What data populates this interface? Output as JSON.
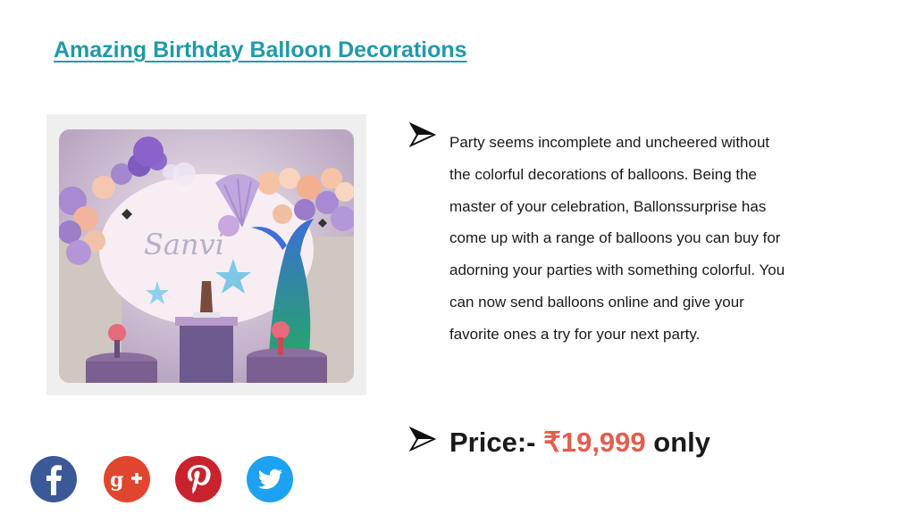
{
  "header": {
    "title": "Amazing Birthday Balloon Decorations"
  },
  "photo": {
    "sign_text": "Sanvi"
  },
  "content": {
    "description": "Party seems incomplete and uncheered without the colorful decorations of balloons. Being the master of your celebration, Ballonssurprise has come up with a range of balloons you can buy for adorning your parties with something colorful. You can now send balloons online and give your favorite ones a try for your next party.",
    "price_label": "Price:- ",
    "price_value": "₹19,999",
    "price_suffix": " only"
  },
  "social": [
    {
      "icon": "facebook-icon",
      "glyph": "f",
      "color": "#3b5998"
    },
    {
      "icon": "google-plus-icon",
      "glyph": "g+",
      "color": "#e0462f"
    },
    {
      "icon": "pinterest-icon",
      "glyph": "p",
      "color": "#c8232c"
    },
    {
      "icon": "twitter-icon",
      "glyph": "bird",
      "color": "#1da1f2"
    }
  ],
  "colors": {
    "title": "#1f9aa8",
    "price": "#e35d4f"
  }
}
